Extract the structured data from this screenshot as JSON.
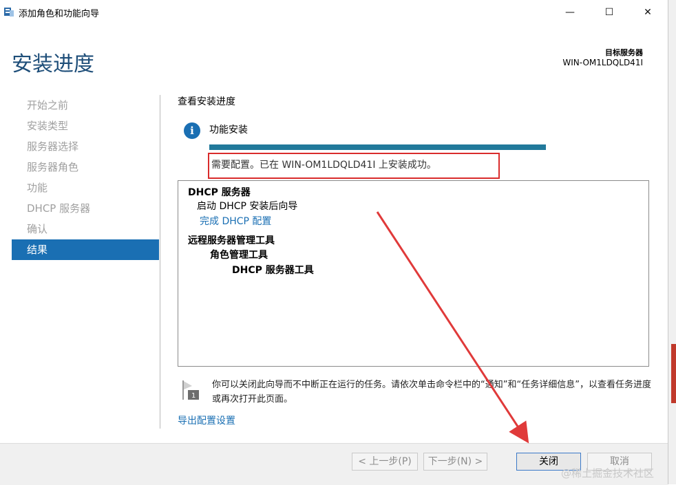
{
  "window": {
    "title": "添加角色和功能向导",
    "controls": [
      "—",
      "☐",
      "✕"
    ]
  },
  "header": {
    "page_title": "安装进度",
    "target_label": "目标服务器",
    "target_value": "WIN-OM1LDQLD41I"
  },
  "sidebar": {
    "items": [
      {
        "label": "开始之前",
        "active": false
      },
      {
        "label": "安装类型",
        "active": false
      },
      {
        "label": "服务器选择",
        "active": false
      },
      {
        "label": "服务器角色",
        "active": false
      },
      {
        "label": "功能",
        "active": false
      },
      {
        "label": "DHCP 服务器",
        "active": false
      },
      {
        "label": "确认",
        "active": false
      },
      {
        "label": "结果",
        "active": true
      }
    ]
  },
  "main": {
    "section_heading": "查看安装进度",
    "feature_label": "功能安装",
    "progress": 1.0,
    "status": "需要配置。已在 WIN-OM1LDQLD41I 上安装成功。",
    "results": {
      "dhcp_server": "DHCP 服务器",
      "start_wizard": "启动 DHCP 安装后向导",
      "complete_config_link": "完成 DHCP 配置",
      "rsat": "远程服务器管理工具",
      "role_admin_tools": "角色管理工具",
      "dhcp_tools": "DHCP 服务器工具"
    },
    "note": "你可以关闭此向导而不中断正在运行的任务。请依次单击命令栏中的“通知”和“任务详细信息”，以查看任务进度或再次打开此页面。",
    "export_link": "导出配置设置"
  },
  "footer": {
    "prev": "< 上一步(P)",
    "next": "下一步(N) >",
    "close": "关闭",
    "cancel": "取消"
  },
  "watermark": "@稀土掘金技术社区",
  "colors": {
    "accent": "#1a6fb3",
    "progress": "#21799b",
    "annotation": "#d92b2b"
  }
}
